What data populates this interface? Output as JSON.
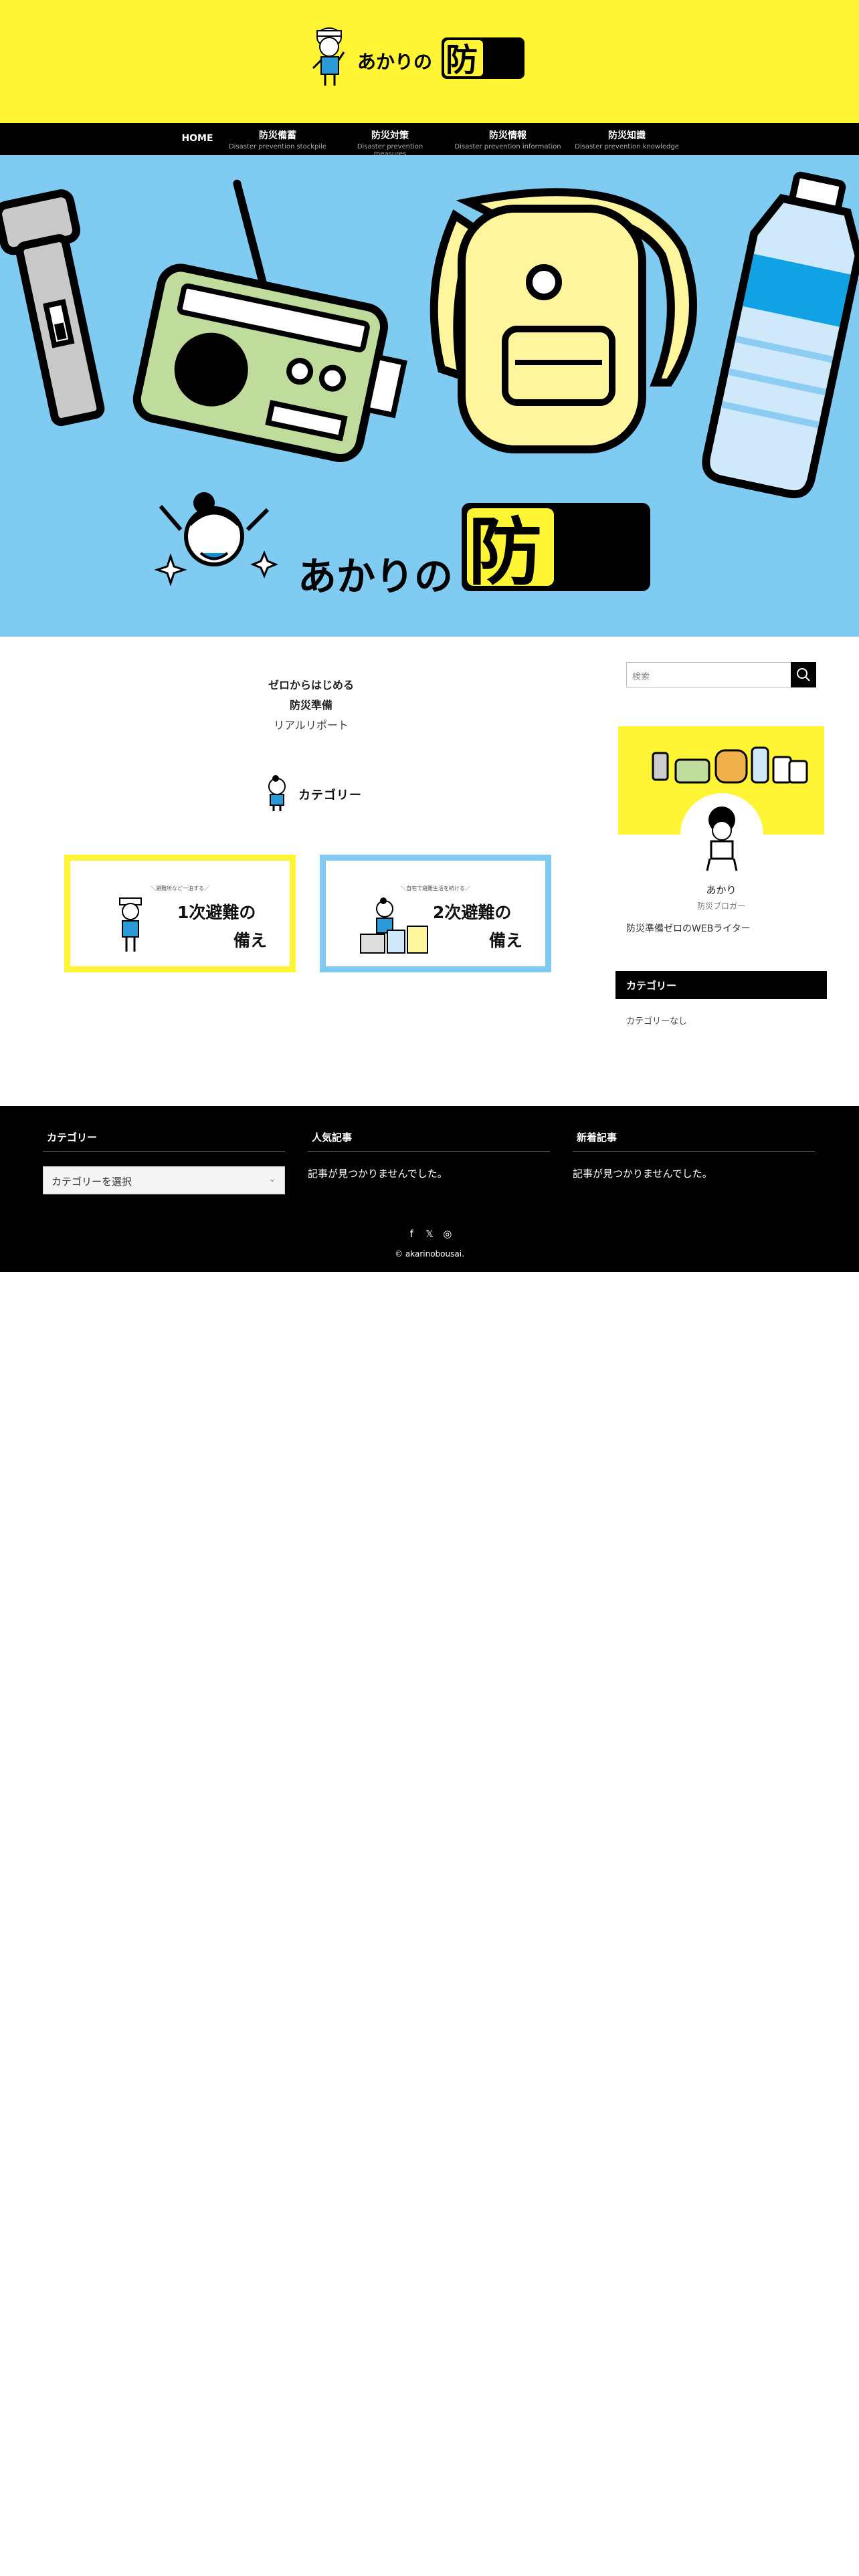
{
  "header": {
    "logo_text": "あかりの",
    "logo_kanji": "防災"
  },
  "nav": {
    "items": [
      {
        "ja": "HOME",
        "en": ""
      },
      {
        "ja": "防災備蓄",
        "en": "Disaster prevention stockpile"
      },
      {
        "ja": "防災対策",
        "en": "Disaster prevention measures"
      },
      {
        "ja": "防災情報",
        "en": "Disaster prevention information"
      },
      {
        "ja": "防災知識",
        "en": "Disaster prevention knowledge"
      }
    ]
  },
  "hero": {
    "logo_text": "あかりの",
    "logo_kanji": "防災"
  },
  "intro": {
    "line1": "ゼロからはじめる",
    "line2": "防災準備",
    "line3": "リアルリポート"
  },
  "category_heading": "カテゴリー",
  "cards": [
    {
      "sub": "＼避難所など一泊する／",
      "title1": "1次避難の",
      "title2": "備え",
      "color": "#fff535"
    },
    {
      "sub": "＼自宅で避難生活を続ける／",
      "title1": "2次避難の",
      "title2": "備え",
      "color": "#7fcbf2"
    }
  ],
  "sidebar": {
    "search_placeholder": "検索",
    "profile_name": "あかり",
    "profile_role": "防災ブロガー",
    "profile_desc": "防災準備ゼロのWEBライター",
    "category_title": "カテゴリー",
    "category_empty": "カテゴリーなし"
  },
  "footer": {
    "col1_title": "カテゴリー",
    "col1_select": "カテゴリーを選択",
    "col2_title": "人気記事",
    "col2_text": "記事が見つかりませんでした。",
    "col3_title": "新着記事",
    "col3_text": "記事が見つかりませんでした。",
    "social_icons": [
      "facebook-icon",
      "x-icon",
      "instagram-icon"
    ],
    "copyright": "© akarinobousai."
  },
  "colors": {
    "yellow": "#fff535",
    "blue": "#7fcbf2",
    "black": "#000000"
  }
}
